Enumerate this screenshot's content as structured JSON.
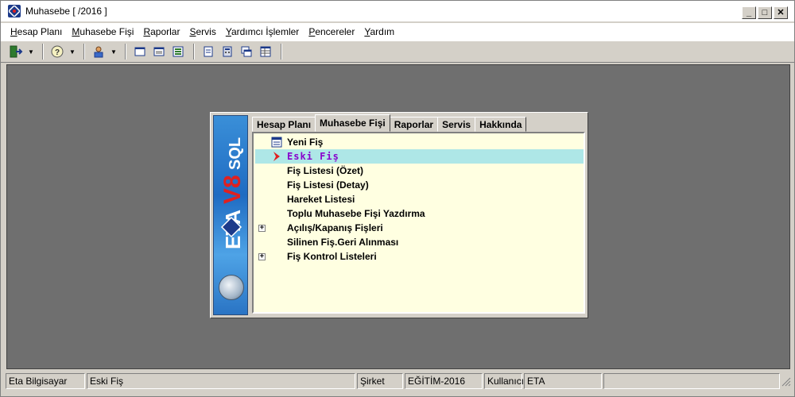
{
  "window": {
    "title": "Muhasebe [ /2016 ]",
    "controls": {
      "minimize": "_",
      "maximize": "□",
      "close": "✕"
    }
  },
  "menubar": [
    {
      "pre": "",
      "u": "H",
      "post": "esap Planı"
    },
    {
      "pre": "",
      "u": "M",
      "post": "uhasebe Fişi"
    },
    {
      "pre": "",
      "u": "R",
      "post": "aporlar"
    },
    {
      "pre": "",
      "u": "S",
      "post": "ervis"
    },
    {
      "pre": "",
      "u": "Y",
      "post": "ardımcı İşlemler"
    },
    {
      "pre": "",
      "u": "P",
      "post": "encereler"
    },
    {
      "pre": "",
      "u": "Y",
      "post": "ardım"
    }
  ],
  "toolbar": {
    "icons": [
      "exit-icon",
      "help-icon",
      "user-icon",
      "cascade-window-icon",
      "tile-window-icon",
      "arrange-icon",
      "form-icon",
      "calculator-icon",
      "window-stack-icon",
      "grid-icon"
    ]
  },
  "panel": {
    "tabs": [
      "Hesap Planı",
      "Muhasebe Fişi",
      "Raporlar",
      "Servis",
      "Hakkında"
    ],
    "active_tab": "Muhasebe Fişi",
    "items": [
      {
        "label": "Yeni Fiş",
        "icon": "new-document-icon",
        "expandable": false,
        "selected": false
      },
      {
        "label": "Eski Fiş",
        "icon": "red-arrow-icon",
        "expandable": false,
        "selected": true
      },
      {
        "label": "Fiş Listesi (Özet)",
        "icon": "",
        "expandable": false,
        "selected": false
      },
      {
        "label": "Fiş Listesi (Detay)",
        "icon": "",
        "expandable": false,
        "selected": false
      },
      {
        "label": "Hareket Listesi",
        "icon": "",
        "expandable": false,
        "selected": false
      },
      {
        "label": "Toplu Muhasebe Fişi Yazdırma",
        "icon": "",
        "expandable": false,
        "selected": false
      },
      {
        "label": "Açılış/Kapanış Fişleri",
        "icon": "",
        "expandable": true,
        "selected": false
      },
      {
        "label": "Silinen Fiş.Geri Alınması",
        "icon": "",
        "expandable": false,
        "selected": false
      },
      {
        "label": "Fiş Kontrol Listeleri",
        "icon": "",
        "expandable": true,
        "selected": false
      }
    ],
    "expander_symbol": "+"
  },
  "statusbar": {
    "company_name": "Eta Bilgisayar",
    "current_screen": "Eski Fiş",
    "sirket_label": "Şirket",
    "sirket_value": "EĞİTİM-2016",
    "kullanici_label": "Kullanıcı",
    "kullanici_value": "ETA"
  },
  "colors": {
    "desktop_bg": "#6f6f6f",
    "tree_bg": "#ffffe1",
    "selected_row_bg": "#aee7e7",
    "selected_row_text": "#8800cc"
  }
}
